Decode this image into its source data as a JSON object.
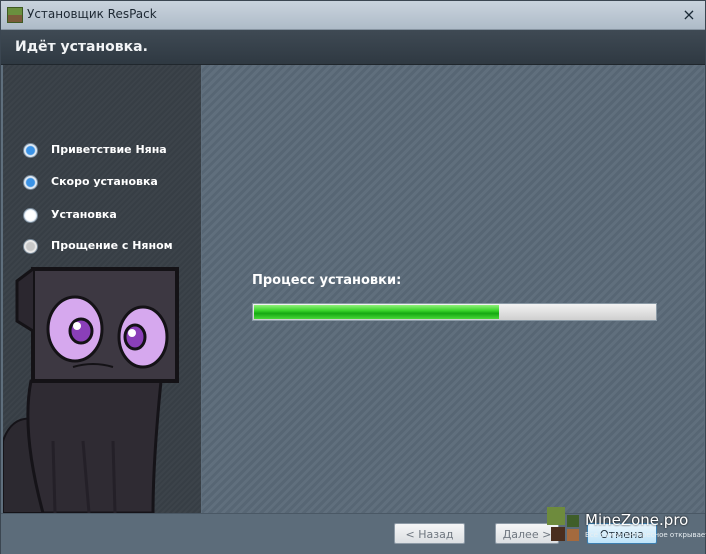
{
  "window": {
    "title": "Установщик ResPack",
    "close_glyph": "×"
  },
  "header": {
    "title": "Идёт установка."
  },
  "sidebar": {
    "steps": [
      {
        "label": "Приветствие Няна",
        "state": "done"
      },
      {
        "label": "Скоро установка",
        "state": "done"
      },
      {
        "label": "Установка",
        "state": "current"
      },
      {
        "label": "Прощение с Няном",
        "state": "pending"
      }
    ]
  },
  "main": {
    "progress_label": "Процесс установки:",
    "progress": 0.61
  },
  "footer": {
    "back_label": "< Назад",
    "next_label": "Далее >",
    "cancel_label": "Отмена"
  },
  "watermark": {
    "text": "MineZone.pro",
    "sub": "Всё самое интересное открывается"
  },
  "colors": {
    "accent": "#3b93e6",
    "progress": "#16a812"
  }
}
